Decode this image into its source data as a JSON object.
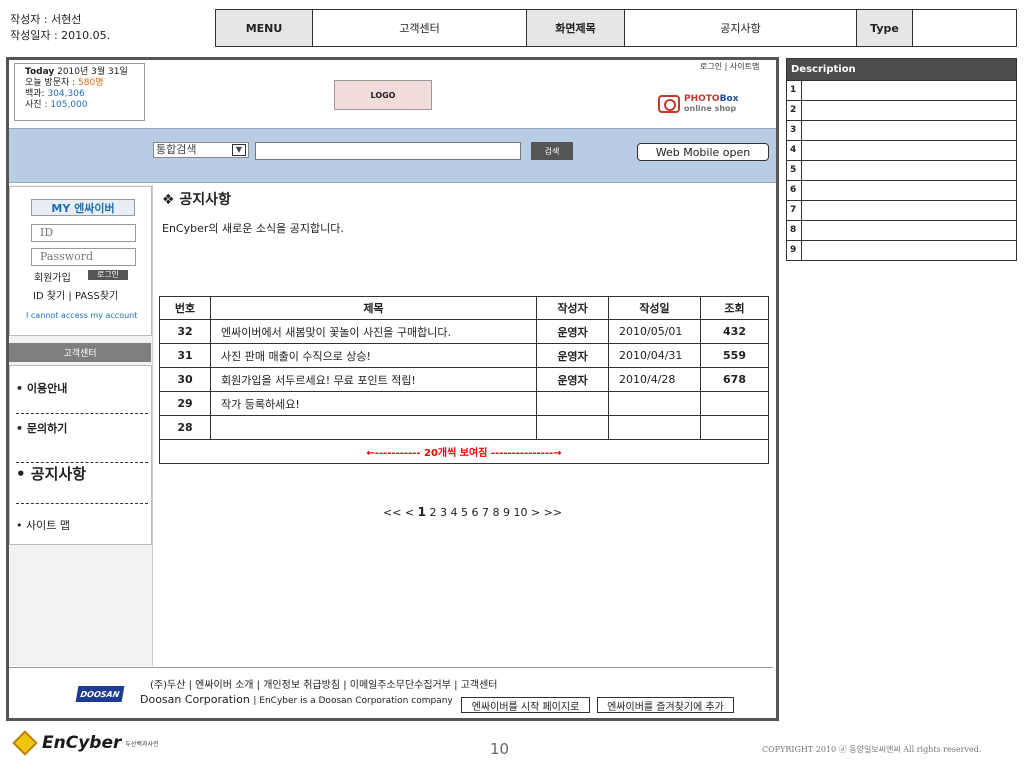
{
  "meta": {
    "author": "작성자 : 서현선",
    "date": "작성일자 : 2010.05.",
    "menu_label": "MENU",
    "menu_value": "고객센터",
    "screen_label": "화면제목",
    "screen_value": "공지사항",
    "type_label": "Type",
    "type_value": ""
  },
  "header": {
    "today_label": "Today",
    "today_date": "2010년 3월 31일",
    "visitors_label": "오늘 방문자 : ",
    "visitors": "580명",
    "encyclopedia_label": "백과: ",
    "encyclopedia": "304,306",
    "photos_label": "사진 : ",
    "photos": "105,000",
    "top_links": "로그인 | 사이트맵",
    "logo": "LOGO",
    "photobox_1": "PHOTO",
    "photobox_2": "Box",
    "photobox_3": "online shop"
  },
  "search": {
    "scope": "통합검색",
    "button": "검색",
    "mobile": "Web Mobile open"
  },
  "login": {
    "title": "MY 엔싸이버",
    "id_placeholder": "ID",
    "password_placeholder": "Password",
    "join": "회원가입",
    "login_button": "로그인",
    "find": "ID 찾기 |  PASS찾기",
    "cannot_access": "I cannot access my account"
  },
  "side_menu": {
    "section": "고객센터",
    "items": [
      "• 이용안내",
      "•  문의하기",
      "• 공지사항",
      "• 사이트 맵"
    ]
  },
  "content": {
    "title": "❖ 공지사항",
    "description": "EnCyber의 새로운 소식을 공지합니다.",
    "columns": [
      "번호",
      "제목",
      "작성자",
      "작성일",
      "조회"
    ],
    "rows": [
      {
        "no": "32",
        "title": "엔싸이버에서 새봄맞이 꽃놀이 사진을 구매합니다.",
        "author": "운영자",
        "date": "2010/05/01",
        "views": "432"
      },
      {
        "no": "31",
        "title": "사진 판매 매출이 수직으로 상승!",
        "author": "운영자",
        "date": "2010/04/31",
        "views": "559"
      },
      {
        "no": "30",
        "title": "회원가입을 서두르세요! 무료 포인트 적립!",
        "author": "운영자",
        "date": "2010/4/28",
        "views": "678"
      },
      {
        "no": "29",
        "title": "작가 등록하세요!",
        "author": "",
        "date": "",
        "views": ""
      },
      {
        "no": "28",
        "title": "",
        "author": "",
        "date": "",
        "views": ""
      }
    ],
    "note": "←----------- 20개씩 보여짐 ---------------→",
    "pager_prev": "<< < ",
    "pager_current": "1",
    "pager_rest": " 2 3 4 5 6 7 8 9 10 > >>"
  },
  "footer": {
    "links": "(주)두산  |  엔싸이버 소개  |  개인정보 취급방침  |  이메일주소무단수집거부  |  고객센터",
    "corp": "Doosan Corporation",
    "corp_sub": "EnCyber is a Doosan Corporation company",
    "btn_start": "엔싸이버를 시작 페이지로",
    "btn_fav": "엔싸이버를 즐겨찾기에 추가",
    "doosan_logo": "DOOSAN"
  },
  "description": {
    "header": "Description",
    "rows": [
      "1",
      "2",
      "3",
      "4",
      "5",
      "6",
      "7",
      "8",
      "9"
    ]
  },
  "bottom": {
    "brand": "EnCyber",
    "brand_sub": "두산백과사전",
    "page": "10",
    "copyright": "COPYRIGHT 2010 ⓓ 동양일보씨앤씨 All rights reserved."
  }
}
